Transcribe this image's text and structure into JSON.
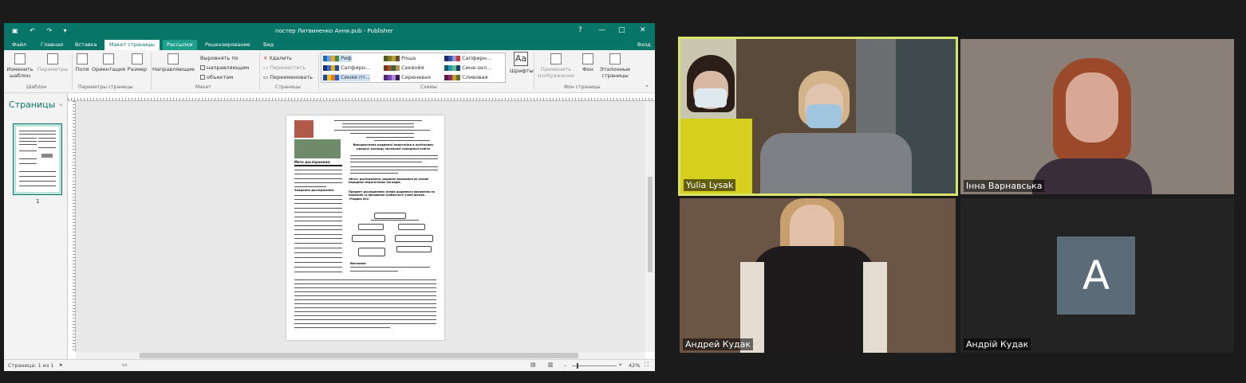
{
  "publisher": {
    "title": "постер Литвиненко Анни.pub - Publisher",
    "window_controls": [
      "?",
      "—",
      "□",
      "✕"
    ],
    "tabs": [
      "Файл",
      "Главная",
      "Вставка",
      "Макет страницы",
      "Рассылки",
      "Рецензирование",
      "Вид"
    ],
    "active_tab": "Макет страницы",
    "signin": "Вход",
    "ribbon": {
      "change_template": "Изменить шаблон",
      "parameters": "Параметры",
      "group_template": "Шаблон",
      "margins": "Поля",
      "orientation": "Ориентация",
      "size": "Размер",
      "group_page_params": "Параметры страницы",
      "guides": "Направляющие",
      "align_by": "Выровнять по",
      "chk_guides": "направляющим",
      "chk_objects": "объектам",
      "group_layout": "Макет",
      "delete": "Удалить",
      "move": "Переместить",
      "rename": "Переименовать",
      "group_pages": "Страницы",
      "schemes": [
        [
          "Риф",
          "Роща",
          "Сапфирн..."
        ],
        [
          "Сапфирн...",
          "Секвойя",
          "Сине-зел..."
        ],
        [
          "Синяя пт...",
          "Сиреневая",
          "Сливовая"
        ]
      ],
      "group_schemes": "Схемы",
      "fonts": "Шрифты",
      "apply_image": "Применить изображение",
      "background": "Фон",
      "master_pages": "Эталонные страницы",
      "group_bg": "Фон страницы"
    },
    "pages_pane": {
      "title": "Страницы",
      "page_num": "1"
    },
    "status": {
      "page": "Страница: 1 из 1",
      "zoom": "42%"
    },
    "poster": {
      "title": "Використання родинної педагогіки в освітньому процесі закладу загальної середньої освіти",
      "object": "Об'єкт дослідження: родинне виховання на основі народних педагогічних поглядів.",
      "subject": "Предмет дослідження: вплив родинного виховання на навчання та виховання особистості учнів школи – «Родина №1»",
      "left_heading": "Мета дослідження:",
      "tasks": "Завдання дослідження:",
      "conclusions": "Висновки"
    }
  },
  "participants": [
    {
      "name": "Yulia Lysak",
      "active_speaker": true
    },
    {
      "name": "Інна Варнавська",
      "active_speaker": false
    },
    {
      "name": "Андрей Кудак",
      "active_speaker": false
    },
    {
      "name": "Андрій Кудак",
      "active_speaker": false,
      "avatar_letter": "A"
    }
  ],
  "colors": {
    "publisher_green": "#077568",
    "speaker_border": "#d9e46c",
    "avatar_bg": "#5b6b78"
  }
}
